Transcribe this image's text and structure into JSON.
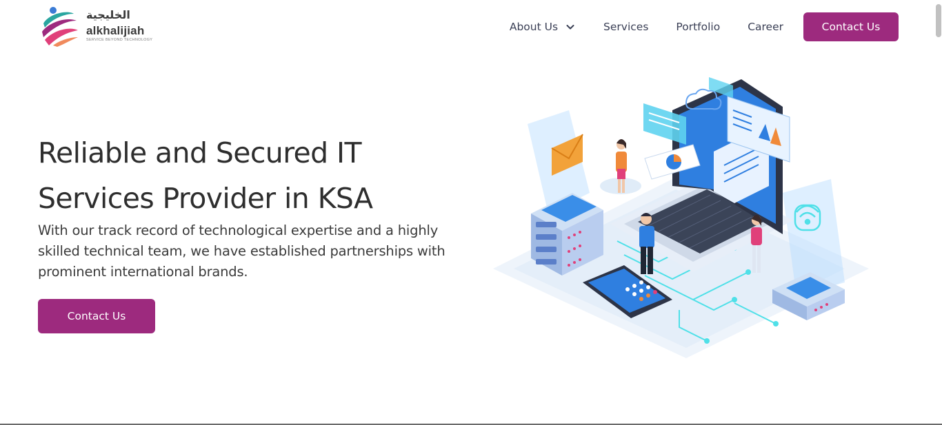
{
  "brand": {
    "arabic_name": "الخليجية",
    "name": "alkhalijiah",
    "tagline": "SERVICE BEYOND TECHNOLOGY",
    "colors": {
      "primary": "#9d2a7e",
      "teal": "#2aa6a0",
      "blue": "#3a7bd5",
      "pink": "#e0407a"
    }
  },
  "nav": {
    "items": [
      {
        "label": "About Us",
        "icon": "chevron-down-icon"
      },
      {
        "label": "Services"
      },
      {
        "label": "Portfolio"
      },
      {
        "label": "Career"
      }
    ],
    "cta_label": "Contact Us"
  },
  "hero": {
    "title_line1": "Reliable and Secured IT",
    "title_line2": "Services Provider in KSA",
    "subtitle": "With our track record of technological expertise and a highly skilled technical team, we have established partnerships with prominent international brands.",
    "cta_label": "Contact Us"
  },
  "illustration": {
    "icons": [
      "laptop-icon",
      "server-icon",
      "smartphone-icon",
      "cloud-icon",
      "wifi-icon",
      "email-icon",
      "people-icon"
    ]
  }
}
